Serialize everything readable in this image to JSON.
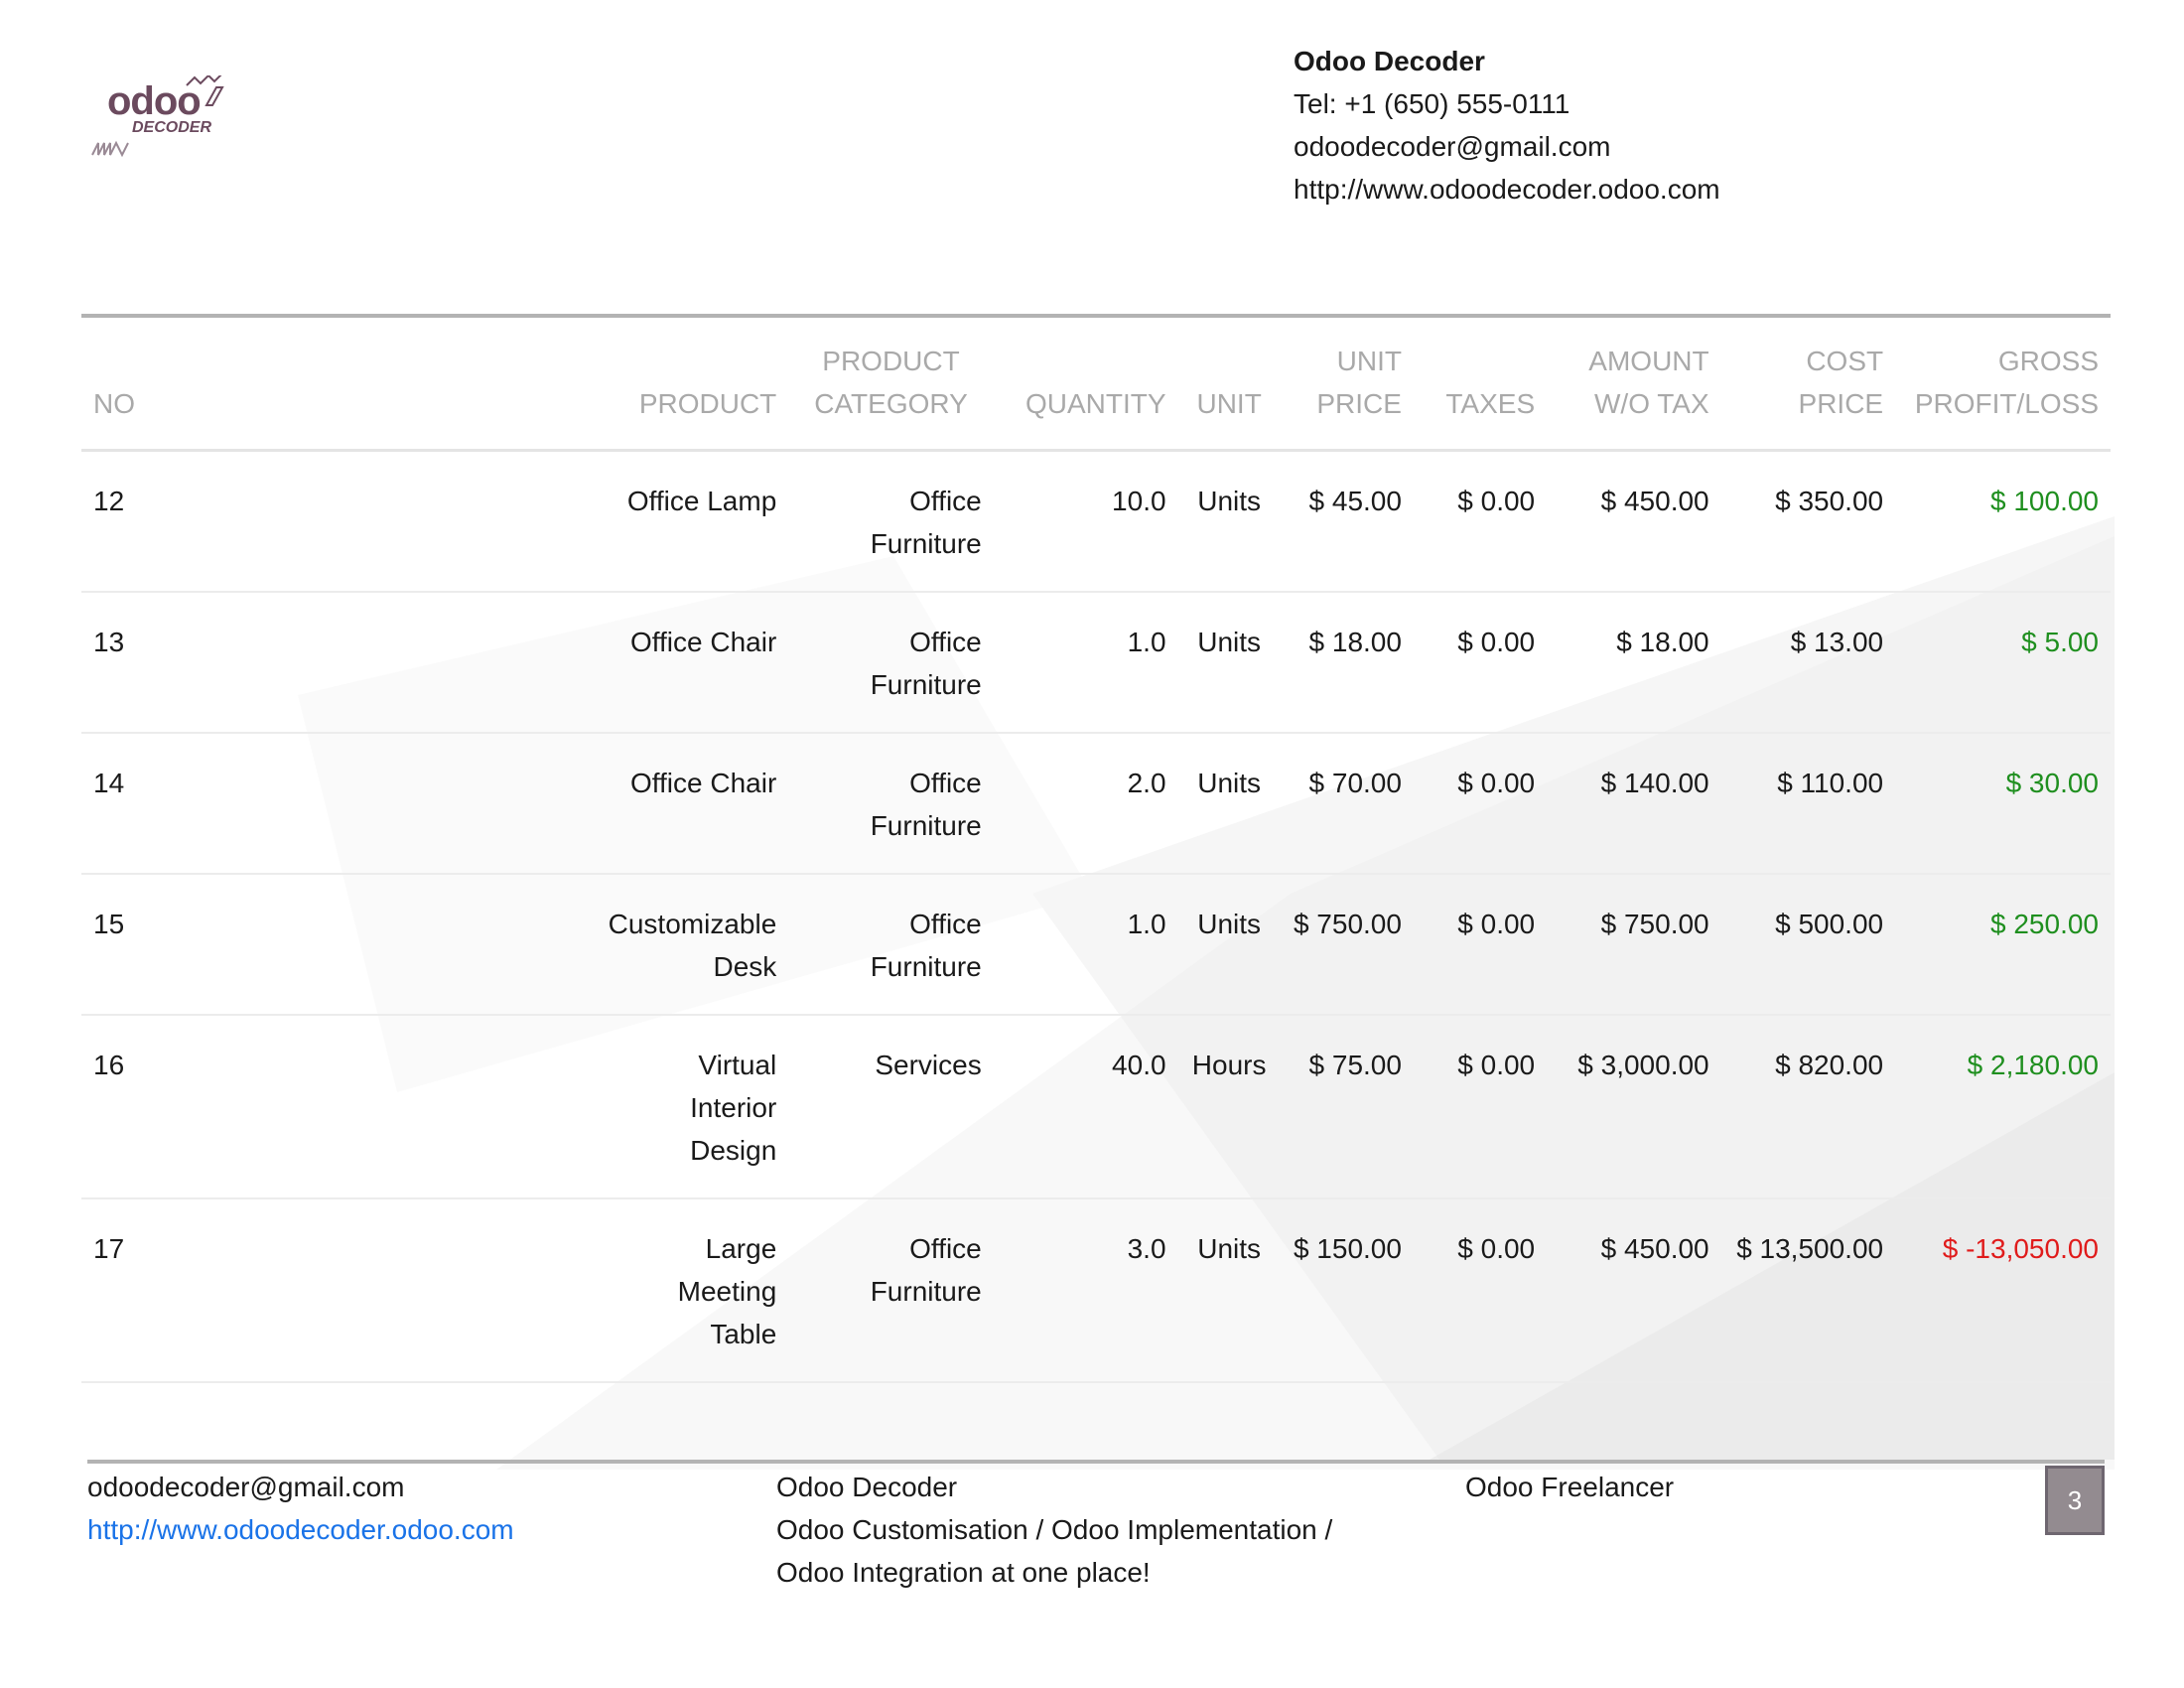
{
  "logo": {
    "word": "odoo",
    "sub": "DECODER"
  },
  "company": {
    "name": "Odoo Decoder",
    "tel": "Tel: +1 (650) 555-0111",
    "email": "odoodecoder@gmail.com",
    "website": "http://www.odoodecoder.odoo.com"
  },
  "table": {
    "headers": [
      {
        "line1": "",
        "line2": "NO"
      },
      {
        "line1": "",
        "line2": "PRODUCT"
      },
      {
        "line1": "PRODUCT",
        "line2": "CATEGORY"
      },
      {
        "line1": "",
        "line2": "QUANTITY"
      },
      {
        "line1": "",
        "line2": "UNIT"
      },
      {
        "line1": "UNIT",
        "line2": "PRICE"
      },
      {
        "line1": "",
        "line2": "TAXES"
      },
      {
        "line1": "AMOUNT",
        "line2": "W/O TAX"
      },
      {
        "line1": "COST",
        "line2": "PRICE"
      },
      {
        "line1": "GROSS",
        "line2": "PROFIT/LOSS"
      }
    ],
    "rows": [
      {
        "no": "12",
        "product": [
          "Office Lamp"
        ],
        "category": [
          "Office",
          "Furniture"
        ],
        "quantity": "10.0",
        "unit": "Units",
        "unit_price": "$ 45.00",
        "taxes": "$ 0.00",
        "amount": "$ 450.00",
        "cost": "$ 350.00",
        "profit": "$ 100.00",
        "profit_status": "pos"
      },
      {
        "no": "13",
        "product": [
          "Office Chair"
        ],
        "category": [
          "Office",
          "Furniture"
        ],
        "quantity": "1.0",
        "unit": "Units",
        "unit_price": "$ 18.00",
        "taxes": "$ 0.00",
        "amount": "$ 18.00",
        "cost": "$ 13.00",
        "profit": "$ 5.00",
        "profit_status": "pos"
      },
      {
        "no": "14",
        "product": [
          "Office Chair"
        ],
        "category": [
          "Office",
          "Furniture"
        ],
        "quantity": "2.0",
        "unit": "Units",
        "unit_price": "$ 70.00",
        "taxes": "$ 0.00",
        "amount": "$ 140.00",
        "cost": "$ 110.00",
        "profit": "$ 30.00",
        "profit_status": "pos"
      },
      {
        "no": "15",
        "product": [
          "Customizable",
          "Desk"
        ],
        "category": [
          "Office",
          "Furniture"
        ],
        "quantity": "1.0",
        "unit": "Units",
        "unit_price": "$ 750.00",
        "taxes": "$ 0.00",
        "amount": "$ 750.00",
        "cost": "$ 500.00",
        "profit": "$ 250.00",
        "profit_status": "pos"
      },
      {
        "no": "16",
        "product": [
          "Virtual",
          "Interior",
          "Design"
        ],
        "category": [
          "Services"
        ],
        "quantity": "40.0",
        "unit": "Hours",
        "unit_price": "$ 75.00",
        "taxes": "$ 0.00",
        "amount": "$ 3,000.00",
        "cost": "$ 820.00",
        "profit": "$ 2,180.00",
        "profit_status": "pos"
      },
      {
        "no": "17",
        "product": [
          "Large",
          "Meeting",
          "Table"
        ],
        "category": [
          "Office",
          "Furniture"
        ],
        "quantity": "3.0",
        "unit": "Units",
        "unit_price": "$ 150.00",
        "taxes": "$ 0.00",
        "amount": "$ 450.00",
        "cost": "$ 13,500.00",
        "profit": "$ -13,050.00",
        "profit_status": "neg"
      }
    ]
  },
  "footer": {
    "email": "odoodecoder@gmail.com",
    "website": "http://www.odoodecoder.odoo.com",
    "company": "Odoo Decoder",
    "tagline_1": "Odoo Customisation / Odoo Implementation /",
    "tagline_2": "Odoo Integration at one place!",
    "freelancer": "Odoo Freelancer",
    "page_number": "3"
  },
  "colors": {
    "profit_positive": "#1f8f1f",
    "profit_negative": "#e01b1b",
    "link": "#1a73e8",
    "header_text": "#a9a9a9"
  }
}
